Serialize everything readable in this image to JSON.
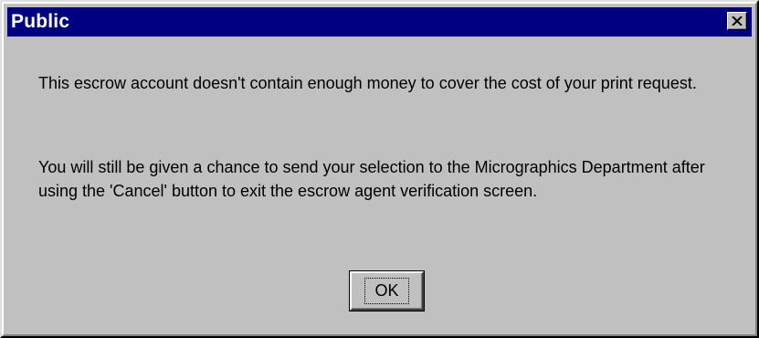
{
  "window": {
    "title": "Public",
    "close_icon": "close-icon"
  },
  "message": {
    "paragraph1": "This escrow account doesn't contain enough money to cover the cost of your print request.",
    "paragraph2": "You will still be given a chance to send your selection to the Micrographics Department after using the 'Cancel' button to exit the escrow agent verification screen."
  },
  "buttons": {
    "ok_label": "OK"
  },
  "colors": {
    "titlebar": "#000080",
    "title_text": "#ffffff",
    "background": "#c0c0c0"
  }
}
